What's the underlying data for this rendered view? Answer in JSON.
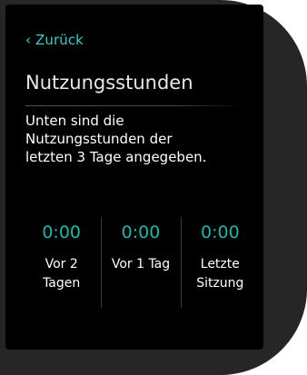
{
  "nav": {
    "back_label": "‹ Zurück"
  },
  "page": {
    "title": "Nutzungsstunden"
  },
  "description": {
    "lines": [
      "Unten sind die",
      "Nutzungsstunden der",
      "letzten 3 Tage angegeben."
    ]
  },
  "usage": [
    {
      "value": "0:00",
      "label_lines": [
        "Vor 2",
        "Tagen"
      ]
    },
    {
      "value": "0:00",
      "label_lines": [
        "Vor 1 Tag"
      ]
    },
    {
      "value": "0:00",
      "label_lines": [
        "Letzte",
        "Sitzung"
      ]
    }
  ],
  "colors": {
    "accent": "#2fd3c8",
    "value_color": "#18b9ad",
    "screen_bg": "#000000",
    "bezel": "#262626"
  }
}
